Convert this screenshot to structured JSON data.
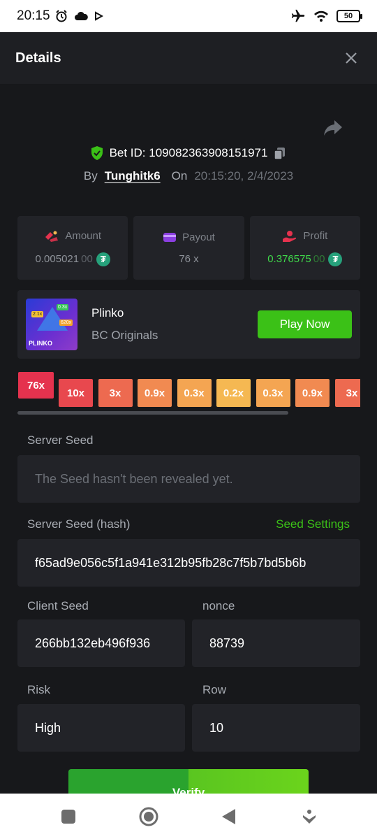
{
  "status_bar": {
    "time": "20:15",
    "battery": "50",
    "left_icons": [
      "alarm-icon",
      "cloud-icon",
      "play-icon"
    ],
    "right_icons": [
      "airplane-icon",
      "wifi-icon",
      "battery-icon"
    ]
  },
  "header": {
    "title": "Details"
  },
  "bet": {
    "id_text": "Bet ID: 109082363908151971",
    "by_label": "By",
    "user": "Tunghitk6",
    "on_label": "On",
    "date": "20:15:20, 2/4/2023"
  },
  "stats": {
    "amount": {
      "label": "Amount",
      "value": "0.00502100",
      "value_main": "0.005021",
      "value_dim": "00",
      "currency_symbol": "₮"
    },
    "payout": {
      "label": "Payout",
      "value": "76 x"
    },
    "profit": {
      "label": "Profit",
      "value": "0.37657500",
      "value_main": "0.376575",
      "value_dim": "00",
      "currency_symbol": "₮"
    }
  },
  "game": {
    "name": "Plinko",
    "provider": "BC Originals",
    "play_label": "Play Now",
    "thumb": {
      "name": "PLINKO",
      "tag1": "2.1x",
      "tag2": "0.3x",
      "tag3": "620x"
    }
  },
  "multipliers": [
    {
      "label": "76x",
      "color": "#e5324e",
      "active": true
    },
    {
      "label": "10x",
      "color": "#e8484e"
    },
    {
      "label": "3x",
      "color": "#ed6a50"
    },
    {
      "label": "0.9x",
      "color": "#f18a51"
    },
    {
      "label": "0.3x",
      "color": "#f4a552"
    },
    {
      "label": "0.2x",
      "color": "#f5b852"
    },
    {
      "label": "0.3x",
      "color": "#f4a552"
    },
    {
      "label": "0.9x",
      "color": "#f18a51"
    },
    {
      "label": "3x",
      "color": "#ed6a50"
    }
  ],
  "fields": {
    "server_seed": {
      "label": "Server Seed",
      "value": "The Seed hasn't been revealed yet."
    },
    "server_seed_hash": {
      "label": "Server Seed (hash)",
      "value": "f65ad9e056c5f1a941e312b95fb28c7f5b7bd5b6b",
      "settings_label": "Seed Settings"
    },
    "client_seed": {
      "label": "Client Seed",
      "value": "266bb132eb496f936"
    },
    "nonce": {
      "label": "nonce",
      "value": "88739"
    },
    "risk": {
      "label": "Risk",
      "value": "High"
    },
    "row": {
      "label": "Row",
      "value": "10"
    }
  },
  "verify_label": "Verify",
  "colors": {
    "accent_green": "#3bc117",
    "profit_green": "#3fd74a",
    "background": "#17181b",
    "panel": "#222328",
    "tether": "#26a17b"
  },
  "nav": [
    "recents-icon",
    "home-icon",
    "back-icon",
    "assistant-icon"
  ]
}
